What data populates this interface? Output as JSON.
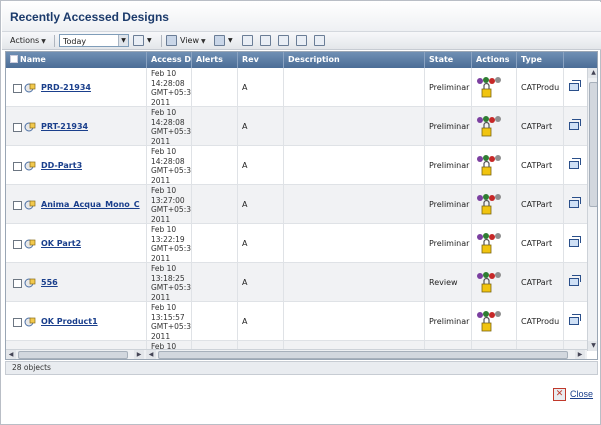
{
  "window": {
    "title": "Recently Accessed Designs"
  },
  "toolbar": {
    "actions_label": "Actions",
    "filter_value": "Today",
    "view_label": "View"
  },
  "columns": [
    "Name",
    "Access D",
    "Alerts",
    "Rev",
    "Description",
    "State",
    "Actions",
    "Type"
  ],
  "rows": [
    {
      "name": "PRD-21934",
      "access_date": "Feb 10\n14:28:08\nGMT+05:3\n2011",
      "alerts": "",
      "rev": "A",
      "description": "",
      "state": "Preliminar",
      "type": "CATProdu"
    },
    {
      "name": "PRT-21934",
      "access_date": "Feb 10\n14:28:08\nGMT+05:3\n2011",
      "alerts": "",
      "rev": "A",
      "description": "",
      "state": "Preliminar",
      "type": "CATPart"
    },
    {
      "name": "DD-Part3",
      "access_date": "Feb 10\n14:28:08\nGMT+05:3\n2011",
      "alerts": "",
      "rev": "A",
      "description": "",
      "state": "Preliminar",
      "type": "CATPart"
    },
    {
      "name": "Anima_Acqua_Mono_C",
      "access_date": "Feb 10\n13:27:00\nGMT+05:3\n2011",
      "alerts": "",
      "rev": "A",
      "description": "",
      "state": "Preliminar",
      "type": "CATPart"
    },
    {
      "name": "OK Part2",
      "access_date": "Feb 10\n13:22:19\nGMT+05:3\n2011",
      "alerts": "",
      "rev": "A",
      "description": "",
      "state": "Preliminar",
      "type": "CATPart"
    },
    {
      "name": "556",
      "access_date": "Feb 10\n13:18:25\nGMT+05:3\n2011",
      "alerts": "",
      "rev": "A",
      "description": "",
      "state": "Review",
      "type": "CATPart"
    },
    {
      "name": "OK Product1",
      "access_date": "Feb 10\n13:15:57\nGMT+05:3\n2011",
      "alerts": "",
      "rev": "A",
      "description": "",
      "state": "Preliminar",
      "type": "CATProdu"
    },
    {
      "name": "",
      "access_date": "Feb 10",
      "alerts": "",
      "rev": "",
      "description": "",
      "state": "",
      "type": ""
    }
  ],
  "status": {
    "count_text": "28 objects"
  },
  "footer": {
    "close_label": "Close"
  },
  "colors": {
    "header": "#4b6d96",
    "link": "#1a3f8c",
    "alt_row": "#f1f2f4"
  }
}
